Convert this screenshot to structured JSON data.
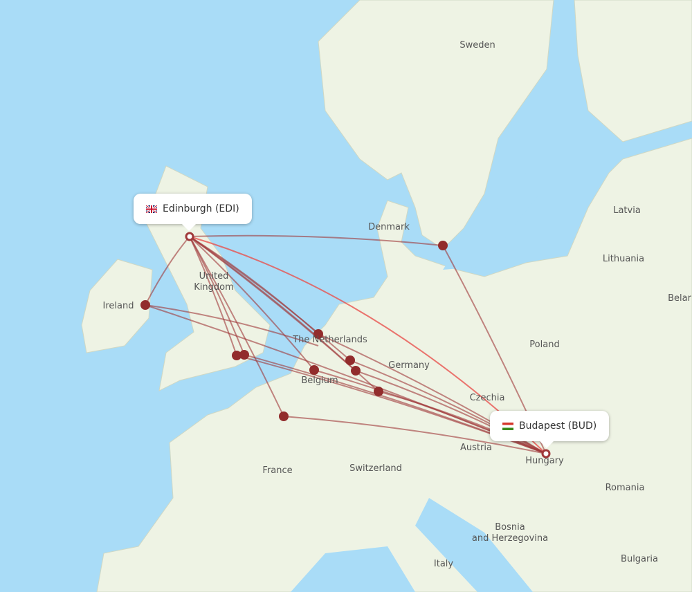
{
  "colors": {
    "ocean": "#a9dcf7",
    "land": "#eef3e4",
    "route": "#a0393a",
    "route_direct": "#e8524f",
    "dot": "#922c2c"
  },
  "origin": {
    "label": "Edinburgh (EDI)",
    "flag": "uk-flag-icon"
  },
  "destination": {
    "label": "Budapest (BUD)",
    "flag": "hungary-flag-icon"
  },
  "place_labels": [
    "Sweden",
    "Denmark",
    "Latvia",
    "Lithuania",
    "Belar",
    "United\nKingdom",
    "Ireland",
    "The Netherlands",
    "Poland",
    "Germany",
    "Belgium",
    "Czechia",
    "Austria",
    "Hungary",
    "France",
    "Switzerland",
    "Romania",
    "Bosnia\nand Herzegovina",
    "Italy",
    "Bulgaria"
  ]
}
